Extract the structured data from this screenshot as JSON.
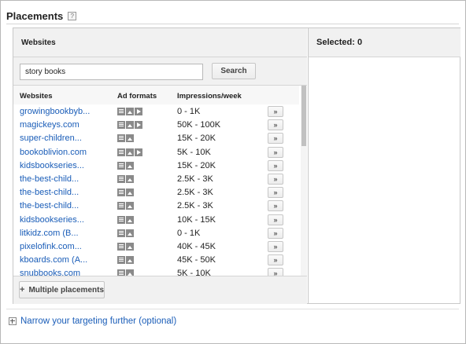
{
  "header": {
    "title": "Placements",
    "help_icon": "?"
  },
  "left_panel": {
    "title": "Websites",
    "search": {
      "value": "story books",
      "button_label": "Search"
    },
    "columns": [
      "Websites",
      "Ad formats",
      "Impressions/week"
    ],
    "rows": [
      {
        "site": "growingbookbyb...",
        "formats": [
          "text",
          "image",
          "video"
        ],
        "impressions": "0 - 1K",
        "add": "»"
      },
      {
        "site": "magickeys.com",
        "formats": [
          "text",
          "image",
          "video"
        ],
        "impressions": "50K - 100K",
        "add": "»"
      },
      {
        "site": "super-children...",
        "formats": [
          "text",
          "image"
        ],
        "impressions": "15K - 20K",
        "add": "»"
      },
      {
        "site": "bookoblivion.com",
        "formats": [
          "text",
          "image",
          "video"
        ],
        "impressions": "5K - 10K",
        "add": "»"
      },
      {
        "site": "kidsbookseries...",
        "formats": [
          "text",
          "image"
        ],
        "impressions": "15K - 20K",
        "add": "»"
      },
      {
        "site": "the-best-child...",
        "formats": [
          "text",
          "image"
        ],
        "impressions": "2.5K - 3K",
        "add": "»"
      },
      {
        "site": "the-best-child...",
        "formats": [
          "text",
          "image"
        ],
        "impressions": "2.5K - 3K",
        "add": "»"
      },
      {
        "site": "the-best-child...",
        "formats": [
          "text",
          "image"
        ],
        "impressions": "2.5K - 3K",
        "add": "»"
      },
      {
        "site": "kidsbookseries...",
        "formats": [
          "text",
          "image"
        ],
        "impressions": "10K - 15K",
        "add": "»"
      },
      {
        "site": "litkidz.com (B...",
        "formats": [
          "text",
          "image"
        ],
        "impressions": "0 - 1K",
        "add": "»"
      },
      {
        "site": "pixelofink.com...",
        "formats": [
          "text",
          "image"
        ],
        "impressions": "40K - 45K",
        "add": "»"
      },
      {
        "site": "kboards.com (A...",
        "formats": [
          "text",
          "image"
        ],
        "impressions": "45K - 50K",
        "add": "»"
      },
      {
        "site": "snubbooks.com",
        "formats": [
          "text",
          "image"
        ],
        "impressions": "5K - 10K",
        "add": "»"
      }
    ],
    "multiple_button": {
      "icon": "+",
      "label": "Multiple placements"
    }
  },
  "right_panel": {
    "title": "Selected: 0"
  },
  "footer": {
    "narrow_link": "Narrow your targeting further (optional)"
  },
  "colors": {
    "link": "#1a5db8",
    "header_bg": "#f1f1f1",
    "icon_gray": "#8a8a8a"
  }
}
